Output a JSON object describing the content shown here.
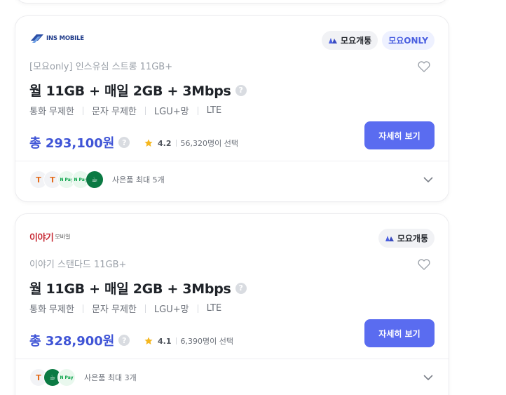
{
  "cards": [
    {
      "logo": {
        "text": "INS MOBILE"
      },
      "badges": [
        {
          "label": "모요개통",
          "icon": "moyo-icon"
        },
        {
          "label": "모요ONLY"
        }
      ],
      "subtitle": "[모요only] 인스유심 스트롱 11GB+",
      "title": "월 11GB + 매일 2GB + 3Mbps",
      "specs": [
        "통화 무제한",
        "문자 무제한",
        "LGU+망",
        "LTE"
      ],
      "price": "총 293,100원",
      "rating": "4.2",
      "selected": "56,320명이 선택",
      "detail_button": "자세히 보기",
      "gifts": [
        "T",
        "T",
        "N Pay",
        "N Pay",
        "starbucks"
      ],
      "gift_label": "사은품 최대 5개"
    },
    {
      "logo": {
        "text": "이야기",
        "sub": "모바일"
      },
      "badges": [
        {
          "label": "모요개통",
          "icon": "moyo-icon"
        }
      ],
      "subtitle": "이야기 스탠다드 11GB+",
      "title": "월 11GB + 매일 2GB + 3Mbps",
      "specs": [
        "통화 무제한",
        "문자 무제한",
        "LGU+망",
        "LTE"
      ],
      "price": "총 328,900원",
      "rating": "4.1",
      "selected": "6,390명이 선택",
      "detail_button": "자세히 보기",
      "gifts": [
        "T",
        "starbucks",
        "N Pay"
      ],
      "gift_label": "사은품 최대 3개"
    }
  ],
  "colors": {
    "accent": "#5a6cf0",
    "price": "#3f54d6",
    "star": "#f5b71f"
  }
}
